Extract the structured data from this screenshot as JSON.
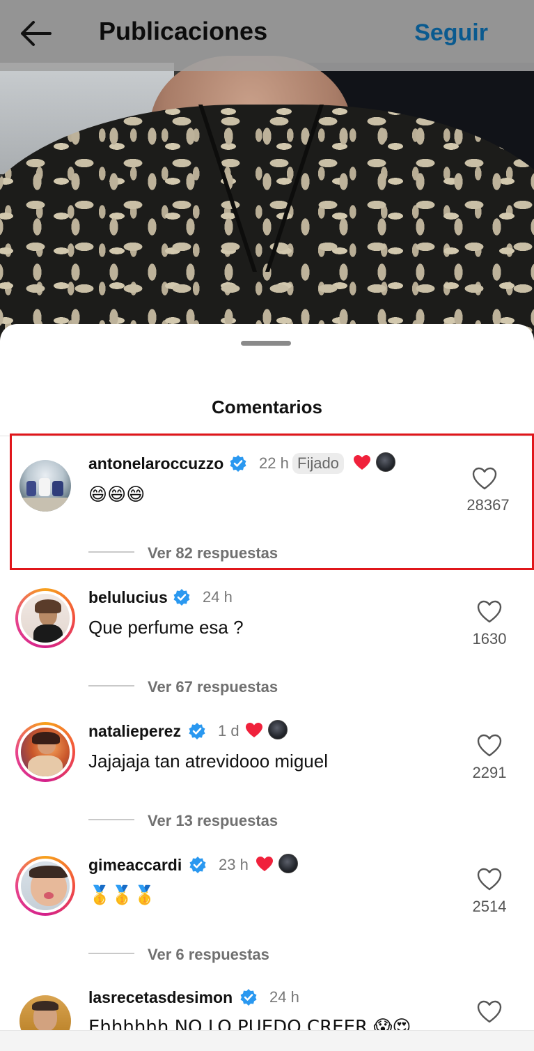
{
  "header": {
    "title": "Publicaciones",
    "follow_label": "Seguir"
  },
  "sheet": {
    "title": "Comentarios"
  },
  "comments": [
    {
      "username": "antonelaroccuzzo",
      "time": "22 h",
      "pinned": "Fijado",
      "text": "😄😄😄",
      "likes": "28367",
      "replies": "Ver 82 respuestas",
      "liked_by_author": true
    },
    {
      "username": "belulucius",
      "time": "24 h",
      "text": "Que perfume esa ?",
      "likes": "1630",
      "replies": "Ver 67 respuestas",
      "liked_by_author": false
    },
    {
      "username": "natalieperez",
      "time": "1 d",
      "text": "Jajajaja tan atrevidooo miguel",
      "likes": "2291",
      "replies": "Ver 13 respuestas",
      "liked_by_author": true
    },
    {
      "username": "gimeaccardi",
      "time": "23 h",
      "text": "🥇🥇🥇",
      "likes": "2514",
      "replies": "Ver 6 respuestas",
      "liked_by_author": true
    },
    {
      "username": "lasrecetasdesimon",
      "time": "24 h",
      "text": "Ehhhhhh NO LO PUEDO CREER 😱😍",
      "likes": "",
      "replies": "",
      "liked_by_author": false
    }
  ],
  "colors": {
    "follow": "#0a5a8f",
    "verified": "#2a98f0",
    "heart_red": "#f0213b",
    "highlight": "#e0161b"
  }
}
